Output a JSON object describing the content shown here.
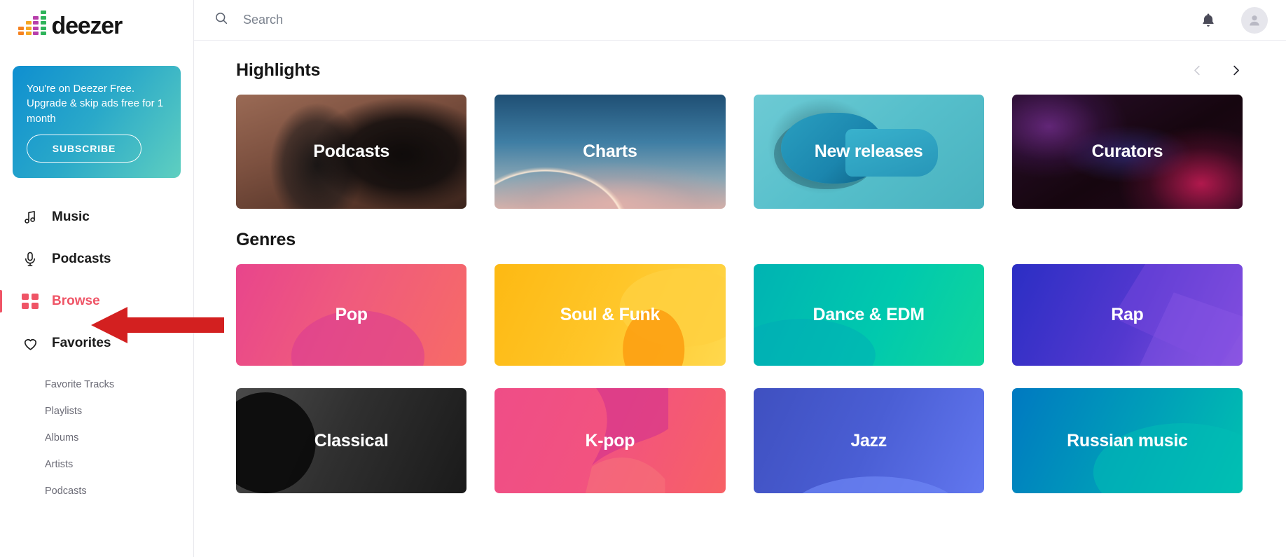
{
  "brand": {
    "name": "deezer",
    "logo_icon": "deezer-equalizer-logo",
    "accent_color": "#ef5466",
    "eq_columns": [
      {
        "color": "#f58220",
        "blocks": 2
      },
      {
        "color": "#f5a623",
        "blocks": 3
      },
      {
        "color": "#b83eab",
        "blocks": 4
      },
      {
        "color": "#2eb35a",
        "blocks": 5
      }
    ]
  },
  "sidebar": {
    "promo": {
      "text": "You're on Deezer Free. Upgrade & skip ads free for 1 month",
      "button_label": "SUBSCRIBE",
      "gradient_from": "#0f8fd0",
      "gradient_to": "#5fcfc0"
    },
    "nav": [
      {
        "label": "Music",
        "icon": "music-note-icon",
        "active": false
      },
      {
        "label": "Podcasts",
        "icon": "microphone-icon",
        "active": false
      },
      {
        "label": "Browse",
        "icon": "grid-icon",
        "active": true
      },
      {
        "label": "Favorites",
        "icon": "heart-icon",
        "active": false
      }
    ],
    "subnav": [
      {
        "label": "Favorite Tracks"
      },
      {
        "label": "Playlists"
      },
      {
        "label": "Albums"
      },
      {
        "label": "Artists"
      },
      {
        "label": "Podcasts"
      }
    ]
  },
  "header": {
    "search": {
      "icon": "search-icon",
      "placeholder": "Search",
      "value": ""
    },
    "notifications_icon": "bell-icon",
    "avatar_icon": "user-avatar-icon"
  },
  "main": {
    "highlights": {
      "title": "Highlights",
      "prev_icon": "chevron-left-icon",
      "next_icon": "chevron-right-icon",
      "prev_enabled": false,
      "next_enabled": true,
      "cards": [
        {
          "label": "Podcasts",
          "art": "bg-podcasts"
        },
        {
          "label": "Charts",
          "art": "bg-charts"
        },
        {
          "label": "New releases",
          "art": "bg-newreleases"
        },
        {
          "label": "Curators",
          "art": "bg-curators"
        }
      ]
    },
    "genres": {
      "title": "Genres",
      "cards": [
        {
          "label": "Pop",
          "art": "bg-pop"
        },
        {
          "label": "Soul & Funk",
          "art": "bg-soul"
        },
        {
          "label": "Dance & EDM",
          "art": "bg-dance"
        },
        {
          "label": "Rap",
          "art": "bg-rap"
        },
        {
          "label": "Classical",
          "art": "bg-classical"
        },
        {
          "label": "K-pop",
          "art": "bg-kpop"
        },
        {
          "label": "Jazz",
          "art": "bg-jazz"
        },
        {
          "label": "Russian music",
          "art": "bg-russian"
        }
      ]
    }
  },
  "annotation": {
    "arrow_icon": "red-pointer-arrow",
    "color": "#d32020",
    "points_at": "Browse"
  }
}
